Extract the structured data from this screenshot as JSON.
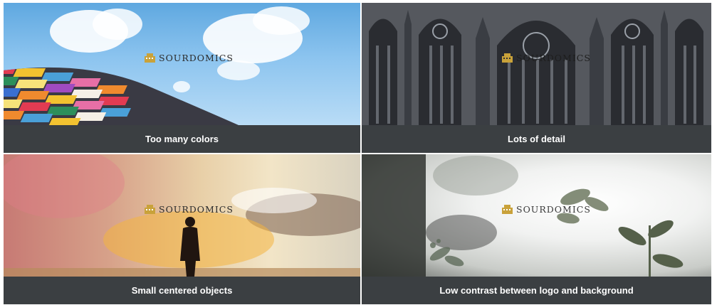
{
  "brand": {
    "name": "SOURDOMICS",
    "color": "#c9a23a"
  },
  "cards": [
    {
      "caption": "Too many colors"
    },
    {
      "caption": "Lots of detail"
    },
    {
      "caption": "Small centered objects"
    },
    {
      "caption": "Low contrast between logo and background"
    }
  ],
  "colors": {
    "caption_bg": "#3b3f42",
    "caption_text": "#ffffff"
  }
}
